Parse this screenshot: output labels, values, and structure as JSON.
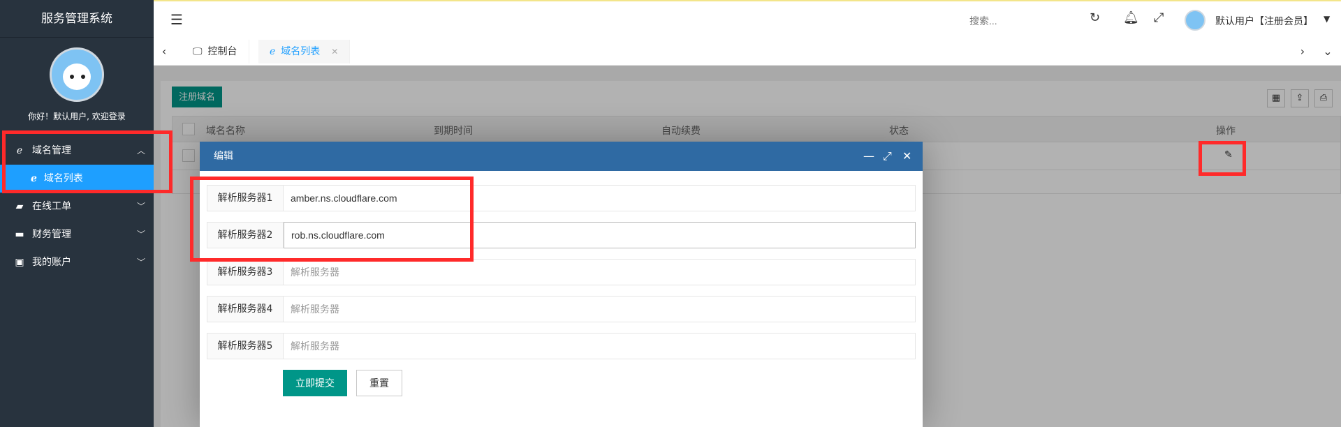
{
  "app": {
    "title": "服务管理系统"
  },
  "profile": {
    "welcome": "你好！默认用户, 欢迎登录"
  },
  "sidebar": {
    "items": [
      {
        "label": "域名管理",
        "icon": "ie-icon",
        "expanded": true
      },
      {
        "label": "域名列表",
        "icon": "ie-icon",
        "active": true
      },
      {
        "label": "在线工单",
        "icon": "book-icon"
      },
      {
        "label": "财务管理",
        "icon": "card-icon"
      },
      {
        "label": "我的账户",
        "icon": "id-card-icon"
      }
    ]
  },
  "header": {
    "search_placeholder": "搜索...",
    "user_name": "默认用户【注册会员】"
  },
  "tabs": [
    {
      "label": "控制台",
      "icon": "monitor-icon"
    },
    {
      "label": "域名列表",
      "icon": "ie-icon",
      "active": true
    }
  ],
  "table": {
    "toolbar": {
      "register_label": "注册域名"
    },
    "columns": [
      "域名名称",
      "到期时间",
      "自动续费",
      "状态",
      "操作"
    ]
  },
  "modal": {
    "title": "编辑",
    "fields": [
      {
        "label": "解析服务器1",
        "value": "amber.ns.cloudflare.com",
        "placeholder": "解析服务器"
      },
      {
        "label": "解析服务器2",
        "value": "rob.ns.cloudflare.com",
        "placeholder": "解析服务器"
      },
      {
        "label": "解析服务器3",
        "value": "",
        "placeholder": "解析服务器"
      },
      {
        "label": "解析服务器4",
        "value": "",
        "placeholder": "解析服务器"
      },
      {
        "label": "解析服务器5",
        "value": "",
        "placeholder": "解析服务器"
      }
    ],
    "submit_label": "立即提交",
    "reset_label": "重置"
  },
  "colors": {
    "sidebar_bg": "#28333e",
    "active_blue": "#1e9fff",
    "green": "#009688",
    "modal_header": "#2f6aa3",
    "highlight_red": "#ff2a2a"
  }
}
